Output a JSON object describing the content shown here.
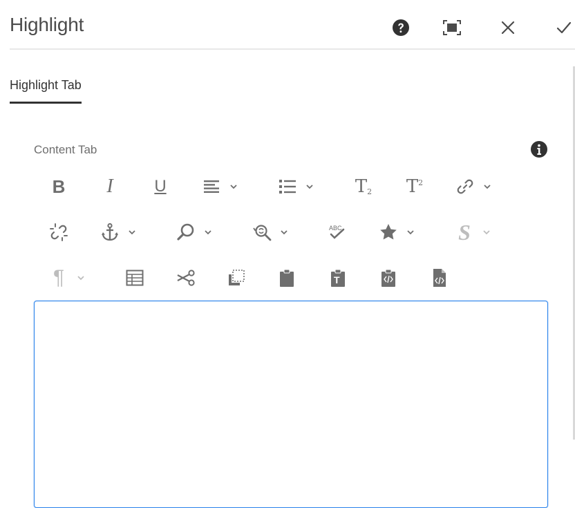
{
  "dialog": {
    "title": "Highlight"
  },
  "tabs": [
    {
      "label": "Highlight Tab"
    }
  ],
  "field": {
    "label": "Content Tab"
  },
  "toolbar": {
    "row1": [
      {
        "name": "bold",
        "glyph": "B"
      },
      {
        "name": "italic",
        "glyph": "I"
      },
      {
        "name": "underline",
        "glyph": "U"
      },
      {
        "name": "justify"
      },
      {
        "name": "list"
      },
      {
        "name": "subscript",
        "glyph": "T",
        "sub": "2"
      },
      {
        "name": "superscript",
        "glyph": "T",
        "sup": "2"
      },
      {
        "name": "link"
      }
    ],
    "row2": [
      {
        "name": "unlink"
      },
      {
        "name": "anchor"
      },
      {
        "name": "find"
      },
      {
        "name": "find-replace"
      },
      {
        "name": "spellcheck",
        "glyph": "ABC"
      },
      {
        "name": "special-chars"
      },
      {
        "name": "styles",
        "glyph": "S"
      }
    ],
    "row3": [
      {
        "name": "paragraph-format",
        "glyph": "¶"
      },
      {
        "name": "table"
      },
      {
        "name": "cut"
      },
      {
        "name": "copy"
      },
      {
        "name": "paste"
      },
      {
        "name": "paste-as-text",
        "glyph": "T"
      },
      {
        "name": "paste-wordhtml"
      },
      {
        "name": "source-edit"
      }
    ]
  },
  "colors": {
    "accent": "#2680eb",
    "icon": "#6e6e6e",
    "dark": "#323232",
    "disabled": "#bdbdbd"
  }
}
